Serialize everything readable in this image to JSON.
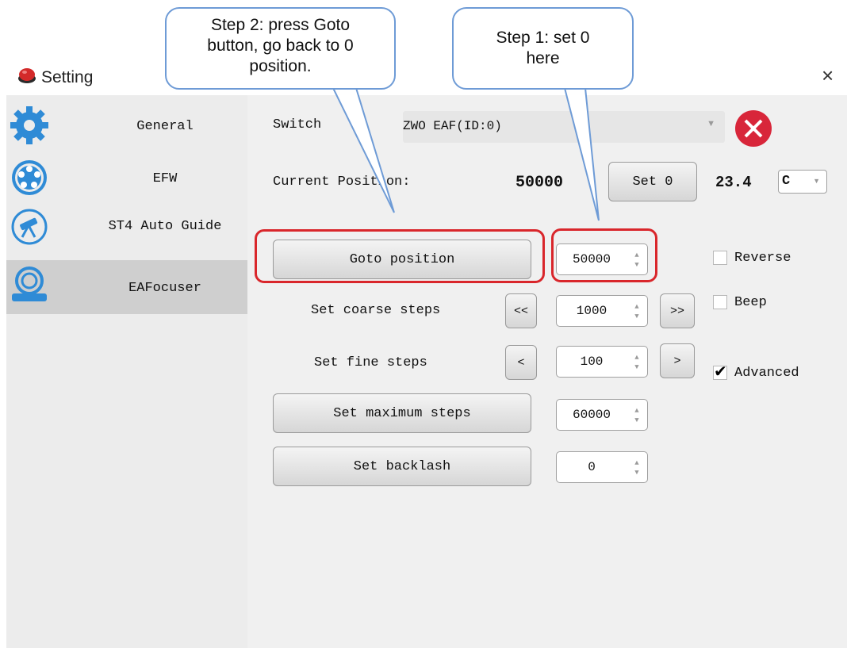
{
  "window": {
    "title": "Setting",
    "close_glyph": "×"
  },
  "sidebar": {
    "items": [
      {
        "label": "General",
        "icon": "gear-icon"
      },
      {
        "label": "EFW",
        "icon": "filter-wheel-icon"
      },
      {
        "label": "ST4 Auto Guide",
        "icon": "telescope-icon"
      },
      {
        "label": "EAFocuser",
        "icon": "focuser-icon",
        "active": true
      }
    ]
  },
  "main": {
    "switch_label": "Switch",
    "device_select": {
      "value": "ZWO EAF(ID:0)"
    },
    "current_position_label": "Current Position:",
    "current_position_value": "50000",
    "set0_label": "Set 0",
    "temperature": "23.4",
    "temp_unit": "C",
    "goto_label": "Goto position",
    "goto_value": "50000",
    "coarse_label": "Set coarse steps",
    "coarse_dec": "<<",
    "coarse_value": "1000",
    "coarse_inc": ">>",
    "fine_label": "Set fine steps",
    "fine_dec": "<",
    "fine_value": "100",
    "fine_inc": ">",
    "max_label": "Set maximum steps",
    "max_value": "60000",
    "backlash_label": "Set backlash",
    "backlash_value": "0",
    "reverse_label": "Reverse",
    "beep_label": "Beep",
    "advanced_label": "Advanced",
    "reverse_checked": false,
    "beep_checked": false,
    "advanced_checked": true
  },
  "callouts": {
    "step2": [
      "Step 2:  press Goto",
      "button, go back to 0",
      "position."
    ],
    "step1": [
      "Step 1:  set 0",
      "here"
    ]
  },
  "colors": {
    "highlight_red": "#d9262b",
    "callout_border": "#6e9bd6",
    "disconnect_red": "#d8263a"
  }
}
